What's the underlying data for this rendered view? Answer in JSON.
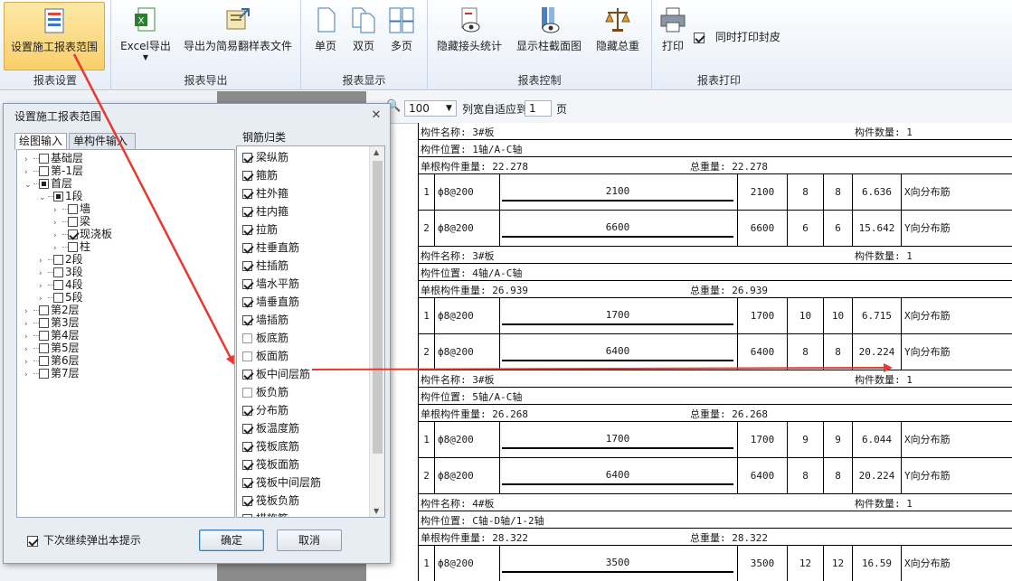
{
  "ribbon": {
    "groups": [
      {
        "label": "报表设置",
        "buttons": [
          {
            "label": "设置施工报表范围",
            "icon": "report-range-icon"
          }
        ]
      },
      {
        "label": "报表导出",
        "buttons": [
          {
            "label": "Excel导出",
            "icon": "excel-icon"
          },
          {
            "label": "导出为简易翻样表文件",
            "icon": "export-file-icon"
          }
        ]
      },
      {
        "label": "报表显示",
        "buttons": [
          {
            "label": "单页",
            "icon": "single-page-icon"
          },
          {
            "label": "双页",
            "icon": "double-page-icon"
          },
          {
            "label": "多页",
            "icon": "multi-page-icon"
          }
        ]
      },
      {
        "label": "报表控制",
        "buttons": [
          {
            "label": "隐藏接头统计",
            "icon": "hide-joint-icon"
          },
          {
            "label": "显示柱截面图",
            "icon": "column-section-icon"
          },
          {
            "label": "隐藏总重",
            "icon": "scale-icon"
          }
        ]
      },
      {
        "label": "报表打印",
        "buttons": [
          {
            "label": "打印",
            "icon": "printer-icon"
          }
        ],
        "checkbox": {
          "label": "同时打印封皮",
          "checked": true
        }
      }
    ]
  },
  "viewer": {
    "zoom": "100",
    "fit_label": "列宽自适应到",
    "pages": "1",
    "page_unit": "页"
  },
  "report": {
    "blocks": [
      {
        "name": "构件名称: 3#板",
        "count": "构件数量: 1",
        "position": "构件位置: 1轴/A-C轴",
        "single_weight": "单根构件重量: 22.278",
        "total_weight": "总重量: 22.278",
        "rows": [
          {
            "no": "1",
            "spec": "ф8@200",
            "shape_len": "2100",
            "len": "2100",
            "n1": "8",
            "n2": "8",
            "weight": "6.636",
            "desc": "X向分布筋"
          },
          {
            "no": "2",
            "spec": "ф8@200",
            "shape_len": "6600",
            "len": "6600",
            "n1": "6",
            "n2": "6",
            "weight": "15.642",
            "desc": "Y向分布筋"
          }
        ]
      },
      {
        "name": "构件名称: 3#板",
        "count": "构件数量: 1",
        "position": "构件位置: 4轴/A-C轴",
        "single_weight": "单根构件重量: 26.939",
        "total_weight": "总重量: 26.939",
        "rows": [
          {
            "no": "1",
            "spec": "ф8@200",
            "shape_len": "1700",
            "len": "1700",
            "n1": "10",
            "n2": "10",
            "weight": "6.715",
            "desc": "X向分布筋"
          },
          {
            "no": "2",
            "spec": "ф8@200",
            "shape_len": "6400",
            "len": "6400",
            "n1": "8",
            "n2": "8",
            "weight": "20.224",
            "desc": "Y向分布筋"
          }
        ]
      },
      {
        "name": "构件名称: 3#板",
        "count": "构件数量: 1",
        "position": "构件位置: 5轴/A-C轴",
        "single_weight": "单根构件重量: 26.268",
        "total_weight": "总重量: 26.268",
        "rows": [
          {
            "no": "1",
            "spec": "ф8@200",
            "shape_len": "1700",
            "len": "1700",
            "n1": "9",
            "n2": "9",
            "weight": "6.044",
            "desc": "X向分布筋"
          },
          {
            "no": "2",
            "spec": "ф8@200",
            "shape_len": "6400",
            "len": "6400",
            "n1": "8",
            "n2": "8",
            "weight": "20.224",
            "desc": "Y向分布筋"
          }
        ]
      },
      {
        "name": "构件名称: 4#板",
        "count": "构件数量: 1",
        "position": "构件位置: C轴-D轴/1-2轴",
        "single_weight": "单根构件重量: 28.322",
        "total_weight": "总重量: 28.322",
        "rows": [
          {
            "no": "1",
            "spec": "ф8@200",
            "shape_len": "3500",
            "len": "3500",
            "n1": "12",
            "n2": "12",
            "weight": "16.59",
            "desc": "X向分布筋"
          }
        ]
      }
    ]
  },
  "dialog": {
    "title": "设置施工报表范围",
    "tabs": [
      "绘图输入",
      "单构件输入"
    ],
    "tree": [
      {
        "label": "基础层",
        "checked": false
      },
      {
        "label": "第-1层",
        "checked": false
      },
      {
        "label": "首层",
        "checked": "partial"
      },
      {
        "label": "1段",
        "checked": "partial"
      },
      {
        "label": "墙",
        "checked": false
      },
      {
        "label": "梁",
        "checked": false
      },
      {
        "label": "现浇板",
        "checked": true
      },
      {
        "label": "柱",
        "checked": false
      },
      {
        "label": "2段",
        "checked": false
      },
      {
        "label": "3段",
        "checked": false
      },
      {
        "label": "4段",
        "checked": false
      },
      {
        "label": "5段",
        "checked": false
      },
      {
        "label": "第2层",
        "checked": false
      },
      {
        "label": "第3层",
        "checked": false
      },
      {
        "label": "第4层",
        "checked": false
      },
      {
        "label": "第5层",
        "checked": false
      },
      {
        "label": "第6层",
        "checked": false
      },
      {
        "label": "第7层",
        "checked": false
      }
    ],
    "category_title": "钢筋归类",
    "categories": [
      {
        "label": "梁纵筋",
        "checked": true
      },
      {
        "label": "箍筋",
        "checked": true
      },
      {
        "label": "柱外箍",
        "checked": true
      },
      {
        "label": "柱内箍",
        "checked": true
      },
      {
        "label": "拉筋",
        "checked": true
      },
      {
        "label": "柱垂直筋",
        "checked": true
      },
      {
        "label": "柱插筋",
        "checked": true
      },
      {
        "label": "墙水平筋",
        "checked": true
      },
      {
        "label": "墙垂直筋",
        "checked": true
      },
      {
        "label": "墙插筋",
        "checked": true
      },
      {
        "label": "板底筋",
        "checked": false
      },
      {
        "label": "板面筋",
        "checked": false
      },
      {
        "label": "板中间层筋",
        "checked": true
      },
      {
        "label": "板负筋",
        "checked": false
      },
      {
        "label": "分布筋",
        "checked": true
      },
      {
        "label": "板温度筋",
        "checked": true
      },
      {
        "label": "筏板底筋",
        "checked": true
      },
      {
        "label": "筏板面筋",
        "checked": true
      },
      {
        "label": "筏板中间层筋",
        "checked": true
      },
      {
        "label": "筏板负筋",
        "checked": true
      },
      {
        "label": "措施筋",
        "checked": true
      }
    ],
    "footer_checkbox": "下次继续弹出本提示",
    "ok": "确定",
    "cancel": "取消"
  },
  "colors": {
    "arrow": "#e8382f",
    "ribbon_active": "#f9cf6a"
  }
}
